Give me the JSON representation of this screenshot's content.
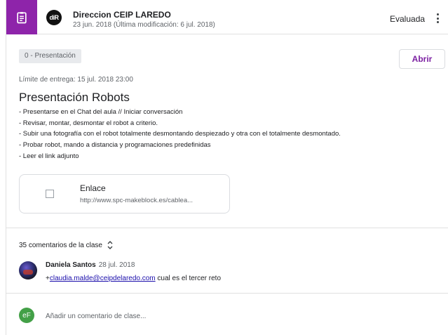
{
  "header": {
    "author": "Direccion CEIP LAREDO",
    "author_initials": "diR",
    "date": "23 jun. 2018 (Última modificación: 6 jul. 2018)",
    "status": "Evaluada",
    "assignment_icon": "assignment-icon",
    "menu_icon": "more-vert-icon",
    "accent_color": "#8e24aa"
  },
  "assignment": {
    "topic": "0 - Presentación",
    "open_label": "Abrir",
    "due": "Límite de entrega: 15 jul. 2018 23:00",
    "title": "Presentación Robots",
    "description": [
      "- Presentarse en el Chat del aula // Iniciar conversación",
      "- Revisar, montar, desmontar el robot a criterio.",
      "- Subir una fotografía con el robot totalmente desmontando despiezado y otra con el totalmente desmontado.",
      "- Probar robot, mando a distancia y programaciones predefinidas",
      "- Leer el link adjunto"
    ],
    "attachment": {
      "title": "Enlace",
      "url": "http://www.spc-makeblock.es/cablea..."
    }
  },
  "comments": {
    "count_label": "35 comentarios de la clase",
    "items": [
      {
        "author": "Daniela Santos",
        "date": "28 jul. 2018",
        "prefix": "+",
        "mention": "claudia.malde@ceipdelaredo.com",
        "text": " cual es el tercer reto"
      }
    ],
    "my_initials": "eF",
    "placeholder": "Añadir un comentario de clase..."
  }
}
